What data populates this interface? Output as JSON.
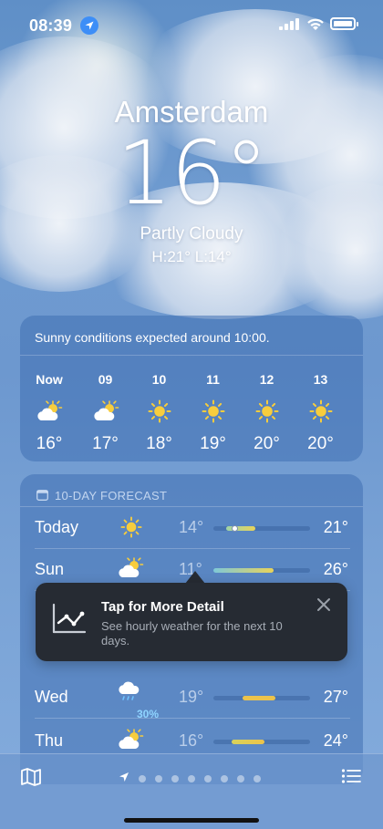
{
  "status_bar": {
    "time": "08:39"
  },
  "hero": {
    "city": "Amsterdam",
    "temperature": "16°",
    "condition": "Partly Cloudy",
    "high_low": "H:21°  L:14°"
  },
  "hourly": {
    "summary": "Sunny conditions expected around 10:00.",
    "hours": [
      {
        "label": "Now",
        "icon": "partly-cloudy-icon",
        "temp": "16°"
      },
      {
        "label": "09",
        "icon": "partly-cloudy-icon",
        "temp": "17°"
      },
      {
        "label": "10",
        "icon": "sun-icon",
        "temp": "18°"
      },
      {
        "label": "11",
        "icon": "sun-icon",
        "temp": "19°"
      },
      {
        "label": "12",
        "icon": "sun-icon",
        "temp": "20°"
      },
      {
        "label": "13",
        "icon": "sun-icon",
        "temp": "20°"
      }
    ]
  },
  "forecast": {
    "heading": "10-DAY FORECAST",
    "days": [
      {
        "name": "Today",
        "icon": "sun-icon",
        "low": "14°",
        "high": "21°",
        "precip": ""
      },
      {
        "name": "Sun",
        "icon": "partly-cloudy-icon",
        "low": "11°",
        "high": "26°",
        "precip": ""
      },
      {
        "name": "Wed",
        "icon": "rain-icon",
        "low": "19°",
        "high": "27°",
        "precip": "30%"
      },
      {
        "name": "Thu",
        "icon": "partly-cloudy-icon",
        "low": "16°",
        "high": "24°",
        "precip": ""
      }
    ]
  },
  "tooltip": {
    "title": "Tap for More Detail",
    "text": "See hourly weather for the next 10 days."
  },
  "colors": {
    "sun": "#f7cd3d",
    "tooltip_bg": "#262b33",
    "location_blue": "#3d8ef7"
  }
}
